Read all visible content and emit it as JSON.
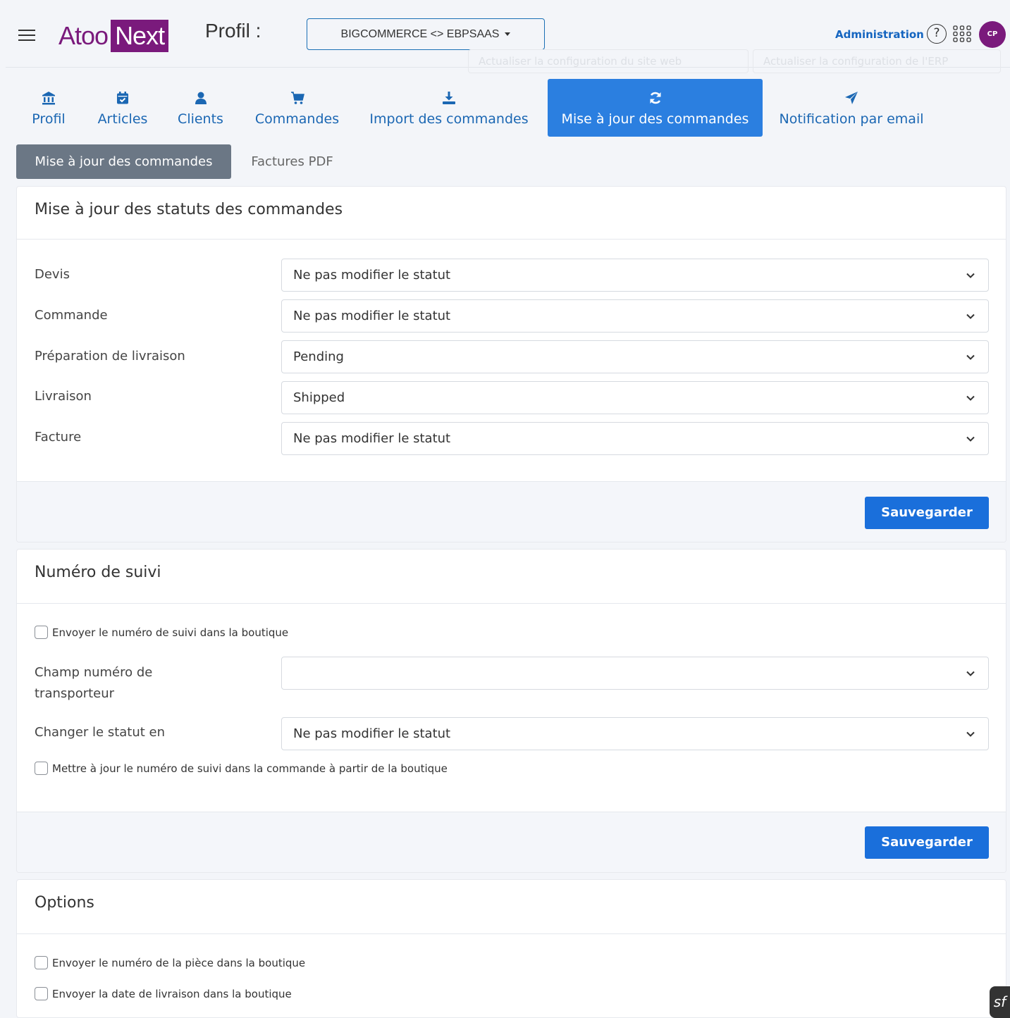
{
  "header": {
    "logo_part1": "Atoo",
    "logo_part2": "Next",
    "profile_label": "Profil :",
    "profile_select": "BIGCOMMERCE <> EBPSAAS",
    "ghost_btn_1": "Actualiser la configuration du site web",
    "ghost_btn_2": "Actualiser la configuration de l'ERP",
    "admin_link": "Administration",
    "help": "?",
    "avatar_initials": "CP"
  },
  "tabs": [
    {
      "label": "Profil",
      "icon": "bank-icon"
    },
    {
      "label": "Articles",
      "icon": "calendar-check-icon"
    },
    {
      "label": "Clients",
      "icon": "user-icon"
    },
    {
      "label": "Commandes",
      "icon": "cart-icon"
    },
    {
      "label": "Import des commandes",
      "icon": "download-icon"
    },
    {
      "label": "Mise à jour des commandes",
      "icon": "refresh-icon",
      "active": true
    },
    {
      "label": "Notification par email",
      "icon": "send-icon"
    }
  ],
  "subtabs": {
    "active": "Mise à jour des commandes",
    "inactive": "Factures PDF"
  },
  "status_card": {
    "title": "Mise à jour des statuts des commandes",
    "rows": [
      {
        "label": "Devis",
        "value": "Ne pas modifier le statut"
      },
      {
        "label": "Commande",
        "value": "Ne pas modifier le statut"
      },
      {
        "label": "Préparation de livraison",
        "value": "Pending"
      },
      {
        "label": "Livraison",
        "value": "Shipped"
      },
      {
        "label": "Facture",
        "value": "Ne pas modifier le statut"
      }
    ],
    "save_label": "Sauvegarder"
  },
  "tracking_card": {
    "title": "Numéro de suivi",
    "send_tracking_label": "Envoyer le numéro de suivi dans la boutique",
    "carrier_field_label": "Champ numéro de transporteur",
    "carrier_field_label_line1": "Champ numéro de",
    "carrier_field_label_line2": "transporteur",
    "carrier_field_value": "",
    "change_status_label": "Changer le statut en",
    "change_status_value": "Ne pas modifier le statut",
    "update_tracking_label": "Mettre à jour le numéro de suivi dans la commande à partir de la boutique",
    "save_label": "Sauvegarder"
  },
  "options_card": {
    "title": "Options",
    "send_piece_number_label": "Envoyer le numéro de la pièce dans la boutique",
    "send_delivery_date_label": "Envoyer la date de livraison dans la boutique"
  },
  "colors": {
    "brand": "#7a1a7c",
    "primary": "#1a6fdb",
    "tab_text": "#1b67b3",
    "subtab_active": "#6b7785"
  }
}
